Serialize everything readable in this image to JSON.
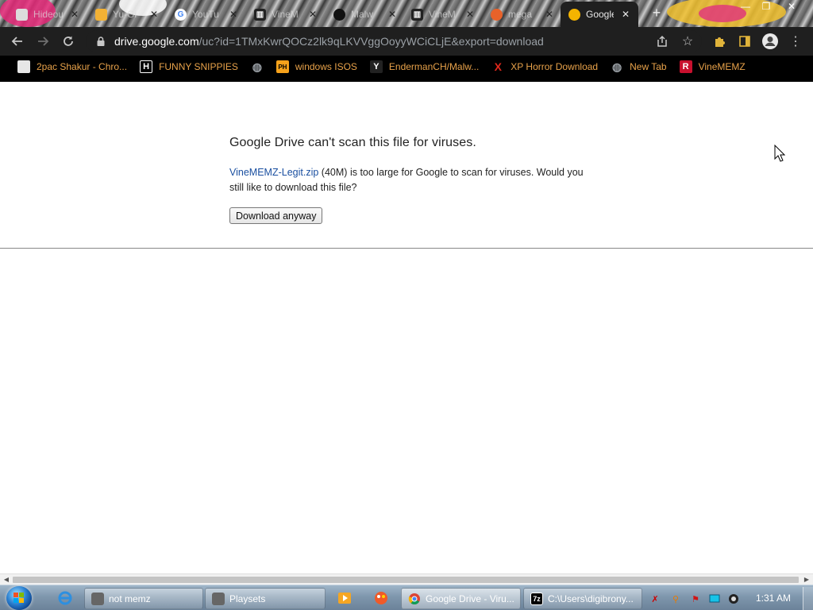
{
  "tabs": [
    {
      "title": "Hideous",
      "favicon": "roblox-icon",
      "favcolor": "#d8d8d8"
    },
    {
      "title": "Yu-Gi",
      "favicon": "cat-icon",
      "favcolor": "#f2b134"
    },
    {
      "title": "YouTu",
      "favicon": "google-icon",
      "favcolor": "#ffffff"
    },
    {
      "title": "VineM",
      "favicon": "archive-icon",
      "favcolor": "#222222"
    },
    {
      "title": "Malw",
      "favicon": "github-icon",
      "favcolor": "#111111"
    },
    {
      "title": "VineM",
      "favicon": "archive-icon",
      "favcolor": "#222222"
    },
    {
      "title": "mega",
      "favicon": "mega-icon",
      "favcolor": "#e8622a"
    },
    {
      "title": "Google",
      "favicon": "drive-icon",
      "favcolor": "#f4b400"
    }
  ],
  "address": {
    "host": "drive.google.com",
    "path": "/uc?id=1TMxKwrQOCz2lk9qLKVVggOoyyWCiCLjE&export=download"
  },
  "bookmarks": [
    {
      "label": "2pac Shakur - Chro...",
      "icon": "roblox-icon",
      "bg": "#e6e6e6",
      "fg": "#000",
      "glyph": "▪"
    },
    {
      "label": "FUNNY SNIPPIES",
      "icon": "h-icon",
      "bg": "#000",
      "fg": "#fff",
      "glyph": "H"
    },
    {
      "label": "",
      "icon": "globe-icon",
      "bg": "transparent",
      "fg": "#9aa0a6",
      "glyph": "◍"
    },
    {
      "label": "windows ISOS",
      "icon": "ph-icon",
      "bg": "#f7a21b",
      "fg": "#000",
      "glyph": "PH"
    },
    {
      "label": "EndermanCH/Malw...",
      "icon": "youtube-pro-icon",
      "bg": "#222",
      "fg": "#fff",
      "glyph": "Y"
    },
    {
      "label": "XP Horror Download",
      "icon": "x-icon",
      "bg": "transparent",
      "fg": "#e0281c",
      "glyph": "X"
    },
    {
      "label": "New Tab",
      "icon": "globe-icon",
      "bg": "transparent",
      "fg": "#9aa0a6",
      "glyph": "◍"
    },
    {
      "label": "VineMEMZ",
      "icon": "roblox-r-icon",
      "bg": "#c8102e",
      "fg": "#fff",
      "glyph": "R"
    }
  ],
  "page": {
    "heading": "Google Drive can't scan this file for viruses.",
    "file_link": "VineMEMZ-Legit.zip",
    "file_size": "(40M)",
    "message_rest": "is too large for Google to scan for viruses. Would you still like to download this file?",
    "download_button": "Download anyway"
  },
  "taskbar": {
    "items": [
      {
        "label": "not memz",
        "icon": "app-icon"
      },
      {
        "label": "Playsets",
        "icon": "app-icon"
      },
      {
        "label": "Google Drive - Viru...",
        "icon": "chrome-icon"
      },
      {
        "label": "C:\\Users\\digibrony...",
        "icon": "7zip-icon"
      }
    ],
    "clock": "1:31 AM"
  }
}
